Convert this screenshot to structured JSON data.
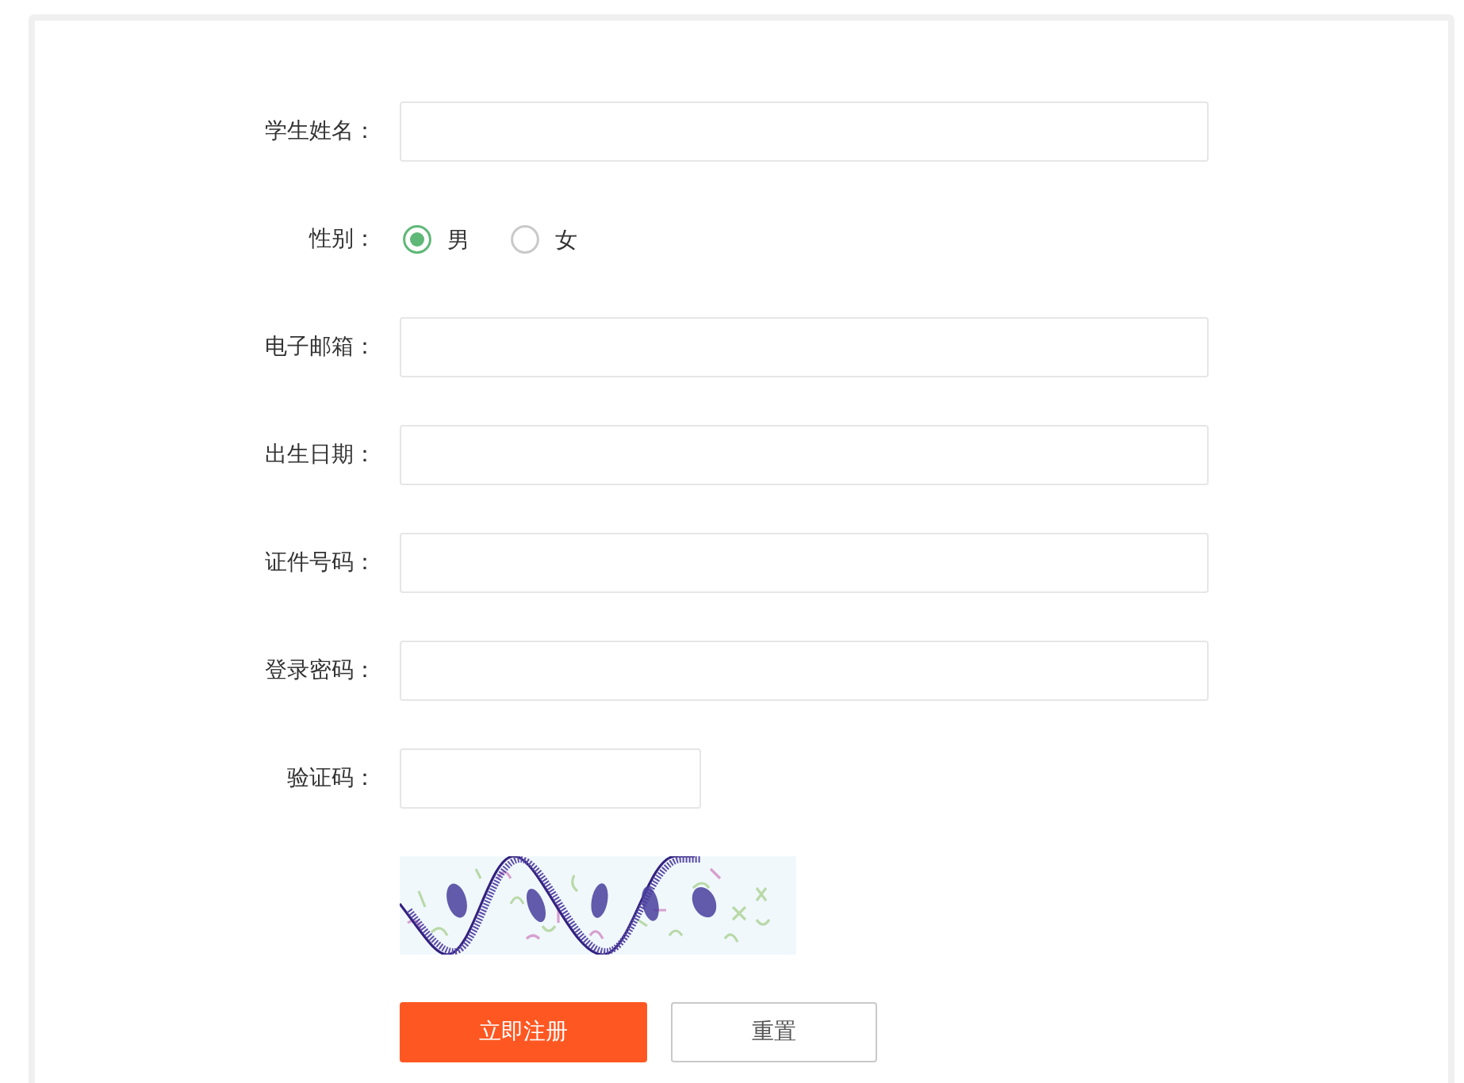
{
  "form": {
    "fields": [
      {
        "kind": "text",
        "label": "学生姓名："
      },
      {
        "kind": "radio",
        "label": "性别：",
        "options": [
          {
            "label": "男",
            "selected": true
          },
          {
            "label": "女",
            "selected": false
          }
        ]
      },
      {
        "kind": "text",
        "label": "电子邮箱："
      },
      {
        "kind": "text",
        "label": "出生日期："
      },
      {
        "kind": "text",
        "label": "证件号码："
      },
      {
        "kind": "text",
        "label": "登录密码："
      },
      {
        "kind": "captcha",
        "label": "验证码："
      }
    ],
    "buttons": [
      {
        "kind": "primary",
        "label": "立即注册"
      },
      {
        "kind": "secondary",
        "label": "重置"
      }
    ]
  }
}
